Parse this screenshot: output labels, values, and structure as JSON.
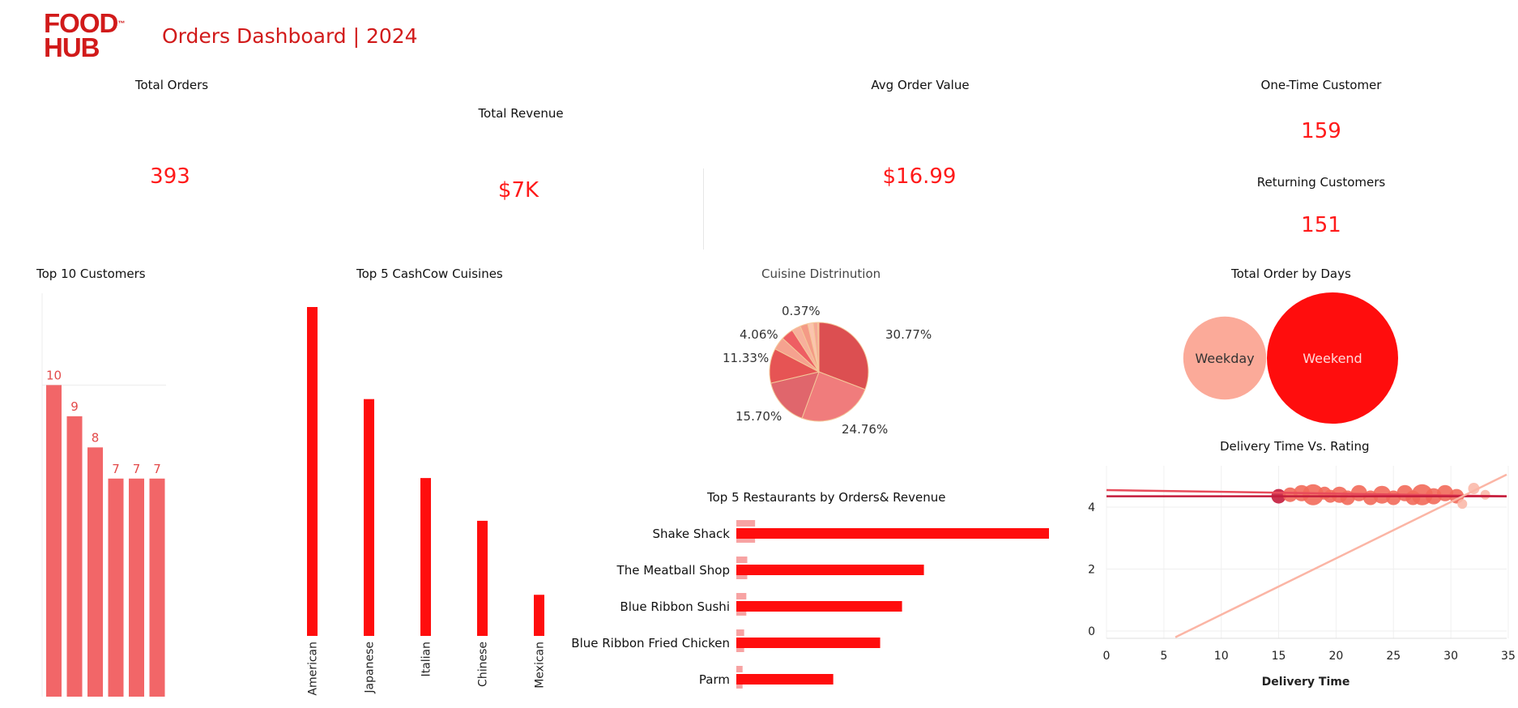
{
  "brand": {
    "logo_line1": "FOOD",
    "logo_line2": "HUB",
    "logo_tm": "™",
    "color": "#d11a1a"
  },
  "dashboard_title": "Orders Dashboard | 2024",
  "kpis": {
    "total_orders": {
      "label": "Total Orders",
      "value": "393"
    },
    "total_revenue": {
      "label": "Total Revenue",
      "value": "$7K"
    },
    "avg_order_value": {
      "label": "Avg Order Value",
      "value": "$16.99"
    },
    "one_time_customer": {
      "label": "One-Time Customer",
      "value": "159"
    },
    "returning_customers": {
      "label": "Returning Customers",
      "value": "151"
    }
  },
  "chart_data": [
    {
      "id": "top10_customers",
      "type": "bar",
      "title": "Top 10 Customers",
      "values": [
        10,
        9,
        8,
        7,
        7,
        7
      ],
      "ylim": [
        0,
        13
      ],
      "color": "#f26668"
    },
    {
      "id": "top5_cuisines",
      "type": "bar",
      "title": "Top 5 CashCow Cuisines",
      "categories": [
        "American",
        "Japanese",
        "Italian",
        "Chinese",
        "Mexican"
      ],
      "values": [
        100,
        72,
        48,
        35,
        12.5
      ],
      "color": "#ff0d0d"
    },
    {
      "id": "cuisine_distribution",
      "type": "pie",
      "title": "Cuisine Distrinution",
      "slices": [
        {
          "label": "30.77%",
          "value": 30.77,
          "color": "#dc4f51"
        },
        {
          "label": "24.76%",
          "value": 24.76,
          "color": "#f07c7c"
        },
        {
          "label": "15.70%",
          "value": 15.7,
          "color": "#e0666c"
        },
        {
          "label": "11.33%",
          "value": 11.33,
          "color": "#e65454"
        },
        {
          "value": 4.2,
          "color": "#f5a28f"
        },
        {
          "label": "4.06%",
          "value": 4.06,
          "color": "#ee5e63"
        },
        {
          "value": 2.9,
          "color": "#f7b09c"
        },
        {
          "value": 2.5,
          "color": "#f49a86"
        },
        {
          "value": 1.8,
          "color": "#fbc3ae"
        },
        {
          "value": 1.5,
          "color": "#f5a896"
        },
        {
          "label": "0.37%",
          "value": 0.37,
          "color": "#f8b9a6"
        }
      ]
    },
    {
      "id": "order_by_days",
      "type": "scatter",
      "title": "Total  Order by Days",
      "points": [
        {
          "label": "Weekday",
          "value": 0.4,
          "color": "#fbaa99"
        },
        {
          "label": "Weekend",
          "value": 1.0,
          "color": "#ff0d0d"
        }
      ]
    },
    {
      "id": "top5_restaurants",
      "type": "bar",
      "title": "Top 5 Restaurants by Orders& Revenue",
      "categories": [
        "Shake Shack",
        "The Meatball Shop",
        "Blue Ribbon Sushi",
        "Blue Ribbon Fried Chicken",
        "Parm"
      ],
      "series": [
        {
          "values": [
            100,
            60,
            53,
            46,
            31
          ],
          "color": "#ff0d0d"
        },
        {
          "values": [
            6,
            3.5,
            3.2,
            2.5,
            2
          ],
          "color": "#f7a3a3"
        }
      ]
    },
    {
      "id": "delivery_vs_rating",
      "type": "scatter",
      "title": "Delivery Time Vs. Rating",
      "xlabel": "Delivery Time",
      "ylabel": "",
      "xlim": [
        0,
        35
      ],
      "ylim": [
        -0.2,
        4.9
      ],
      "xticks": [
        "0",
        "5",
        "10",
        "15",
        "20",
        "25",
        "30",
        "35"
      ],
      "yticks": [
        "0",
        "2",
        "4"
      ],
      "points": [
        {
          "x": 15,
          "y": 4.35,
          "r": 9,
          "color": "#c41c3c"
        },
        {
          "x": 16,
          "y": 4.4,
          "r": 9,
          "color": "#f26a5a"
        },
        {
          "x": 17,
          "y": 4.45,
          "r": 10,
          "color": "#f26a5a"
        },
        {
          "x": 18,
          "y": 4.4,
          "r": 13,
          "color": "#f26a5a"
        },
        {
          "x": 19,
          "y": 4.45,
          "r": 8,
          "color": "#f26a5a"
        },
        {
          "x": 19.5,
          "y": 4.35,
          "r": 8,
          "color": "#f26a5a"
        },
        {
          "x": 20.3,
          "y": 4.4,
          "r": 10,
          "color": "#f26a5a"
        },
        {
          "x": 21,
          "y": 4.3,
          "r": 9,
          "color": "#f26a5a"
        },
        {
          "x": 22,
          "y": 4.45,
          "r": 10,
          "color": "#f26a5a"
        },
        {
          "x": 23,
          "y": 4.3,
          "r": 9,
          "color": "#f26a5a"
        },
        {
          "x": 24,
          "y": 4.4,
          "r": 11,
          "color": "#f26a5a"
        },
        {
          "x": 25,
          "y": 4.3,
          "r": 9,
          "color": "#f26a5a"
        },
        {
          "x": 26,
          "y": 4.45,
          "r": 10,
          "color": "#f26a5a"
        },
        {
          "x": 26.7,
          "y": 4.3,
          "r": 9,
          "color": "#f26a5a"
        },
        {
          "x": 27.5,
          "y": 4.4,
          "r": 13,
          "color": "#f26a5a"
        },
        {
          "x": 28.5,
          "y": 4.35,
          "r": 10,
          "color": "#f26a5a"
        },
        {
          "x": 29.5,
          "y": 4.45,
          "r": 10,
          "color": "#f26a5a"
        },
        {
          "x": 30.5,
          "y": 4.35,
          "r": 9,
          "color": "#f26a5a"
        },
        {
          "x": 32,
          "y": 4.6,
          "r": 7,
          "color": "#fbb9aa"
        },
        {
          "x": 33,
          "y": 4.4,
          "r": 6,
          "color": "#fbb9aa"
        },
        {
          "x": 31,
          "y": 4.1,
          "r": 6,
          "color": "#fbb9aa"
        }
      ],
      "trend_lines": [
        {
          "x1": 0,
          "y1": 4.55,
          "x2": 35,
          "y2": 4.35,
          "color": "#e84a5a"
        },
        {
          "x1": 0,
          "y1": 4.35,
          "x2": 35,
          "y2": 4.35,
          "color": "#c41c3c"
        },
        {
          "x1": 6,
          "y1": -0.2,
          "x2": 35,
          "y2": 5.05,
          "color": "#fbb5a5"
        }
      ]
    }
  ]
}
